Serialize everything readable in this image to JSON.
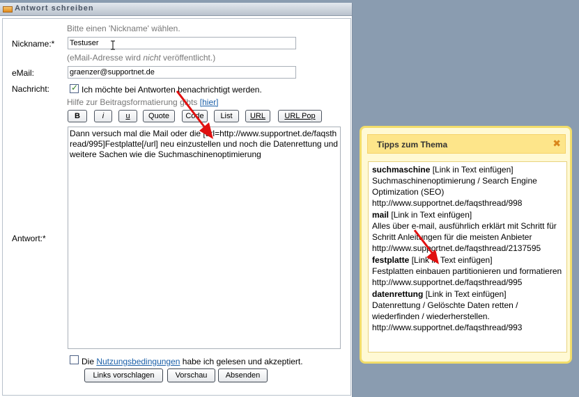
{
  "window": {
    "title": "Antwort schreiben"
  },
  "form": {
    "nickname_hint": "Bitte einen 'Nickname' wählen.",
    "nickname_label": "Nickname:*",
    "nickname_value": "Testuser",
    "email_hint_pre": "(eMail-Adresse wird ",
    "email_hint_em": "nicht",
    "email_hint_post": " veröffentlicht.)",
    "email_label": "eMail:",
    "email_value": "graenzer@supportnet.de",
    "message_label": "Nachricht:",
    "notify_label": "Ich möchte bei Antworten benachrichtigt werden.",
    "notify_checked": true,
    "format_help_text": "Hilfe zur Beitragsformatierung gibts",
    "format_help_link": "[hier]",
    "format_buttons": [
      "B",
      "i",
      "u",
      "Quote",
      "Code",
      "List",
      "URL",
      "URL Pop"
    ],
    "answer_label": "Antwort:*",
    "answer_value": "Dann versuch mal die Mail oder die [url=http://www.supportnet.de/faqsthread/995]Festplatte[/url] neu einzustellen und noch die Datenrettung und weitere Sachen wie die Suchmaschinenoptimierung",
    "terms_pre": "Die ",
    "terms_link": "Nutzungsbedingungen",
    "terms_post": " habe ich gelesen und akzeptiert.",
    "terms_checked": false,
    "buttons": {
      "suggest": "Links vorschlagen",
      "preview": "Vorschau",
      "submit": "Absenden"
    }
  },
  "tips": {
    "title": "Tipps zum Thema",
    "close": "✖",
    "items": [
      {
        "keyword": "suchmaschine",
        "action": "[Link in Text einfügen]",
        "desc": "Suchmaschinenoptimierung / Search Engine Optimization (SEO)",
        "url": "http://www.supportnet.de/faqsthread/998"
      },
      {
        "keyword": "mail",
        "action": "[Link in Text einfügen]",
        "desc": "Alles über e-mail, ausführlich erklärt mit Schritt für Schritt Anleitungen für die meisten Anbieter",
        "url": "http://www.supportnet.de/faqsthread/2137595"
      },
      {
        "keyword": "festplatte",
        "action": "[Link in Text einfügen]",
        "desc": "Festplatten einbauen partitionieren und formatieren",
        "url": "http://www.supportnet.de/faqsthread/995"
      },
      {
        "keyword": "datenrettung",
        "action": "[Link in Text einfügen]",
        "desc": "Datenrettung / Gelöschte Daten retten / wiederfinden / wiederherstellen.",
        "url": "http://www.supportnet.de/faqsthread/993"
      }
    ]
  },
  "colors": {
    "arrow": "#e01010",
    "link": "#1a5fa8",
    "tips_border": "#f2dd6a"
  }
}
